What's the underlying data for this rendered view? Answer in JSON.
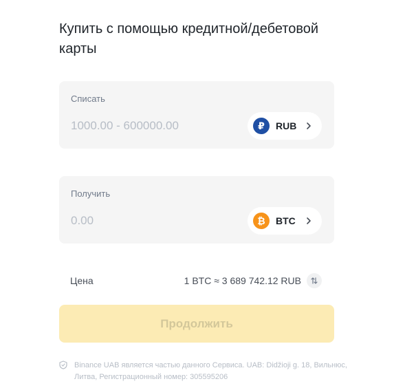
{
  "title": "Купить с помощью кредитной/дебетовой карты",
  "spend": {
    "label": "Списать",
    "placeholder": "1000.00 - 600000.00",
    "currency": "RUB",
    "coin_symbol": "₽"
  },
  "receive": {
    "label": "Получить",
    "placeholder": "0.00",
    "currency": "BTC",
    "coin_symbol": "₿"
  },
  "price": {
    "label": "Цена",
    "value": "1 BTC ≈ 3 689 742.12 RUB"
  },
  "continue_label": "Продолжить",
  "footer_text": "Binance UAB является частью данного Сервиса. UAB: Didžioji g. 18, Вильнюс, Литва, Регистрационный номер: 305595206",
  "colors": {
    "rub_coin": "#1f4fa4",
    "btc_coin": "#f7931a",
    "button_disabled_bg": "#fcebb4",
    "button_disabled_text": "#d3c79a"
  },
  "icons": {
    "spend_currency": "ruble-coin-icon",
    "receive_currency": "bitcoin-coin-icon",
    "selector": "chevron-right-icon",
    "swap": "swap-vertical-icon",
    "footer": "shield-icon"
  }
}
